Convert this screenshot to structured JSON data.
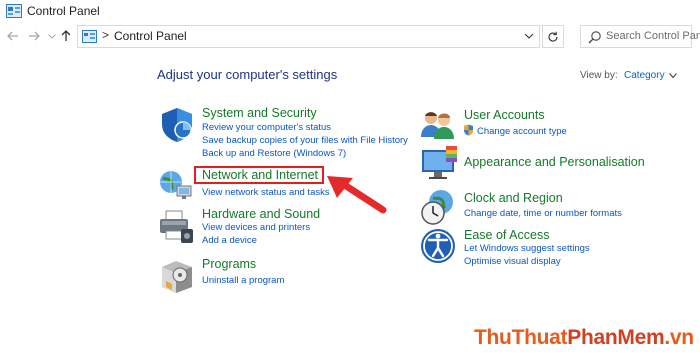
{
  "window": {
    "title": "Control Panel"
  },
  "address": {
    "separator": ">",
    "crumb": "Control Panel"
  },
  "search": {
    "placeholder": "Search Control Panel"
  },
  "content": {
    "heading": "Adjust your computer's settings",
    "view_by_label": "View by:",
    "view_by_value": "Category"
  },
  "categories": [
    {
      "title": "System and Security",
      "icon": "shield-icon",
      "links": [
        "Review your computer's status",
        "Save backup copies of your files with File History",
        "Back up and Restore (Windows 7)"
      ]
    },
    {
      "title": "Network and Internet",
      "icon": "globe-network-icon",
      "links": [
        "View network status and tasks"
      ]
    },
    {
      "title": "Hardware and Sound",
      "icon": "printer-icon",
      "links": [
        "View devices and printers",
        "Add a device"
      ]
    },
    {
      "title": "Programs",
      "icon": "programs-box-icon",
      "links": [
        "Uninstall a program"
      ]
    },
    {
      "title": "User Accounts",
      "icon": "users-icon",
      "links": [
        "Change account type"
      ]
    },
    {
      "title": "Appearance and Personalisation",
      "icon": "monitor-palette-icon",
      "links": []
    },
    {
      "title": "Clock and Region",
      "icon": "clock-globe-icon",
      "links": [
        "Change date, time or number formats"
      ]
    },
    {
      "title": "Ease of Access",
      "icon": "accessibility-icon",
      "links": [
        "Let Windows suggest settings",
        "Optimise visual display"
      ]
    }
  ],
  "watermark": {
    "part1": "ThuThuat",
    "part2": "PhanMem",
    "part3": ".vn"
  },
  "colors": {
    "accent_red": "#e02020",
    "title_green": "#157a29",
    "link_blue": "#0b56c4"
  }
}
